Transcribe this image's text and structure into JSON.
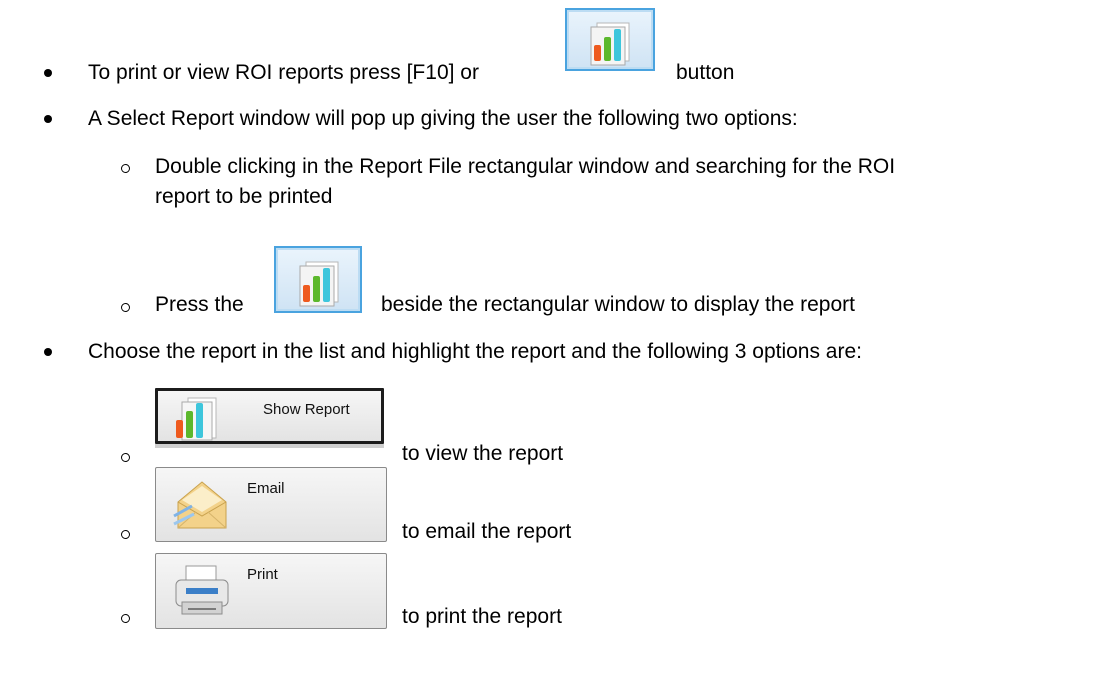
{
  "items": {
    "b1_before": "To print or view ROI reports press [F10] or",
    "b1_after": "button",
    "b2": "A Select Report window will pop up giving the user the following two options:",
    "s1_line1": "Double clicking in the Report File rectangular window and searching for the ROI",
    "s1_line2": "report to be printed",
    "s2_before": "Press the",
    "s2_after": "beside the rectangular window to display the report",
    "b3": "Choose the report in the list and highlight the report and the following 3 options are:",
    "s3_after": "to view the report",
    "s4_after": "to email the report",
    "s5_after": "to print the report"
  },
  "buttons": {
    "show_report": "Show Report",
    "email": "Email",
    "print": "Print"
  },
  "icons": {
    "chart": "bar-chart-icon",
    "envelope": "envelope-icon",
    "printer": "printer-icon"
  },
  "colors": {
    "button_accent": "#4aa3df",
    "bar_orange": "#ee5a1e",
    "bar_green": "#5cb82c",
    "bar_cyan": "#3ec6dc"
  }
}
